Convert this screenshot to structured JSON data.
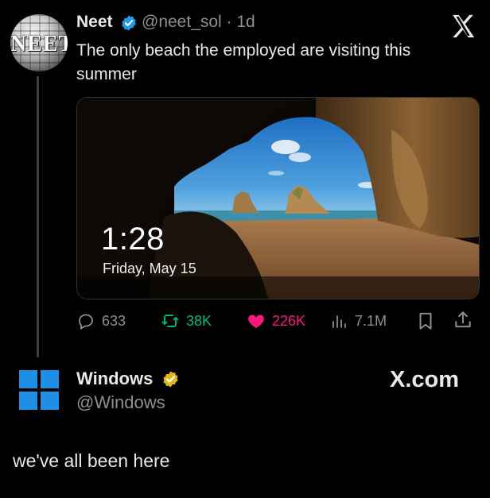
{
  "tweet": {
    "author_name": "Neet",
    "handle_time": "@neet_sol · 1d",
    "avatar_text": "NEET",
    "text": "The only beach the employed are visiting this summer",
    "media": {
      "time": "1:28",
      "date": "Friday, May 15"
    },
    "actions": {
      "replies": "633",
      "retweets": "38K",
      "likes": "226K",
      "views": "7.1M"
    }
  },
  "overlay": {
    "brand": "X.com"
  },
  "windows_post": {
    "name": "Windows",
    "handle": "@Windows",
    "caption": "we've all been here"
  },
  "colors": {
    "background": "#000000",
    "retweet": "#00ba7c",
    "like": "#f91880",
    "verified_blue": "#1d9bf0",
    "verified_gold": "#e2b719",
    "windows_blue": "#1f8fe6"
  },
  "icons": [
    "verified-badge-icon",
    "x-logo-icon",
    "reply-icon",
    "retweet-icon",
    "heart-icon",
    "views-icon",
    "bookmark-icon",
    "share-icon",
    "windows-logo-icon",
    "gold-verified-icon"
  ]
}
